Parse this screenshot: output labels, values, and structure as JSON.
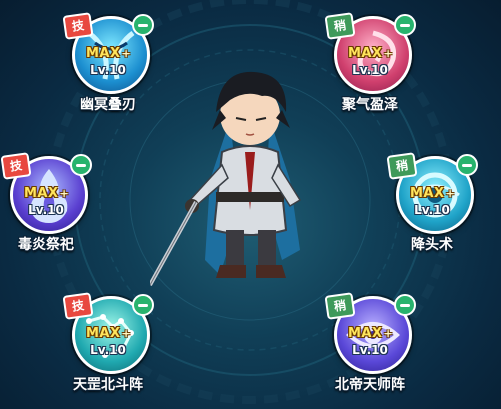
{
  "skills": [
    {
      "tag": "技",
      "max": "MAX",
      "plus": "+",
      "level": "Lv.10",
      "name": "幽冥叠刃",
      "icon": "twin-blade-icon",
      "colors": [
        "#7fe8ff",
        "#1c8fd0"
      ]
    },
    {
      "tag": "稍",
      "max": "MAX",
      "plus": "+",
      "level": "Lv.10",
      "name": "聚气盈泽",
      "icon": "swirl-energy-icon",
      "colors": [
        "#ffb0c8",
        "#d0406e"
      ]
    },
    {
      "tag": "技",
      "max": "MAX",
      "plus": "+",
      "level": "Lv.10",
      "name": "毒炎祭祀",
      "icon": "blue-flame-icon",
      "colors": [
        "#a9b8ff",
        "#5a3fd0"
      ]
    },
    {
      "tag": "稍",
      "max": "MAX",
      "plus": "+",
      "level": "Lv.10",
      "name": "降头术",
      "icon": "eye-spiral-icon",
      "colors": [
        "#8ff0ff",
        "#1fa3c8"
      ]
    },
    {
      "tag": "技",
      "max": "MAX",
      "plus": "+",
      "level": "Lv.10",
      "name": "天罡北斗阵",
      "icon": "constellation-icon",
      "colors": [
        "#9ff6e8",
        "#20a9b0"
      ]
    },
    {
      "tag": "稍",
      "max": "MAX",
      "plus": "+",
      "level": "Lv.10",
      "name": "北帝天师阵",
      "icon": "seal-eye-icon",
      "colors": [
        "#b9b0ff",
        "#5a48d8"
      ]
    }
  ]
}
